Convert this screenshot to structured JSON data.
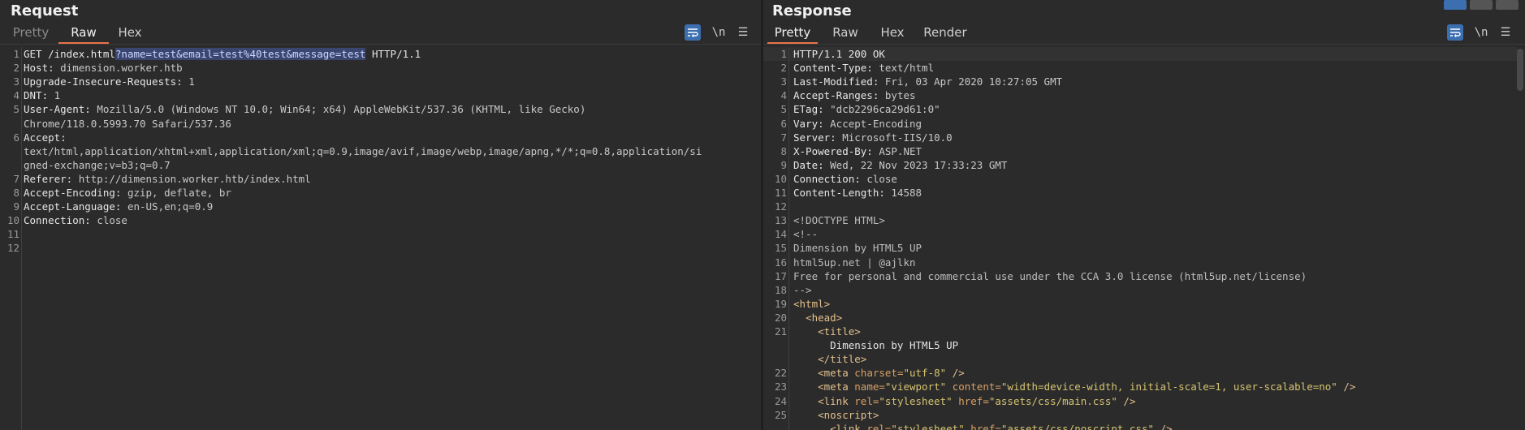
{
  "request": {
    "title": "Request",
    "tabs": [
      "Pretty",
      "Raw",
      "Hex"
    ],
    "active_tab": "Raw",
    "tools": {
      "wrap": "wrap-icon",
      "newline": "\\n",
      "menu": "☰"
    },
    "line_numbers": [
      "1",
      "2",
      "3",
      "4",
      "5",
      "",
      "6",
      "",
      "",
      "7",
      "8",
      "9",
      "10",
      "11",
      "12"
    ],
    "lines": [
      {
        "segments": [
          {
            "t": "GET /index.html",
            "c": "hkey"
          },
          {
            "t": "?name=test&email=test%40test&message=test",
            "c": "sel"
          },
          {
            "t": " HTTP/1.1",
            "c": "hkey"
          }
        ]
      },
      {
        "segments": [
          {
            "t": "Host: ",
            "c": "hkey"
          },
          {
            "t": "dimension.worker.htb",
            "c": "hval"
          }
        ]
      },
      {
        "segments": [
          {
            "t": "Upgrade-Insecure-Requests: ",
            "c": "hkey"
          },
          {
            "t": "1",
            "c": "hval"
          }
        ]
      },
      {
        "segments": [
          {
            "t": "DNT: ",
            "c": "hkey"
          },
          {
            "t": "1",
            "c": "hval"
          }
        ]
      },
      {
        "segments": [
          {
            "t": "User-Agent: ",
            "c": "hkey"
          },
          {
            "t": "Mozilla/5.0 (Windows NT 10.0; Win64; x64) AppleWebKit/537.36 (KHTML, like Gecko)",
            "c": "hval"
          }
        ]
      },
      {
        "segments": [
          {
            "t": "Chrome/118.0.5993.70 Safari/537.36",
            "c": "hval"
          }
        ]
      },
      {
        "segments": [
          {
            "t": "Accept: ",
            "c": "hkey"
          }
        ]
      },
      {
        "segments": [
          {
            "t": "text/html,application/xhtml+xml,application/xml;q=0.9,image/avif,image/webp,image/apng,*/*;q=0.8,application/si",
            "c": "hval"
          }
        ]
      },
      {
        "segments": [
          {
            "t": "gned-exchange;v=b3;q=0.7",
            "c": "hval"
          }
        ]
      },
      {
        "segments": [
          {
            "t": "Referer: ",
            "c": "hkey"
          },
          {
            "t": "http://dimension.worker.htb/index.html",
            "c": "hval"
          }
        ]
      },
      {
        "segments": [
          {
            "t": "Accept-Encoding: ",
            "c": "hkey"
          },
          {
            "t": "gzip, deflate, br",
            "c": "hval"
          }
        ]
      },
      {
        "segments": [
          {
            "t": "Accept-Language: ",
            "c": "hkey"
          },
          {
            "t": "en-US,en;q=0.9",
            "c": "hval"
          }
        ]
      },
      {
        "segments": [
          {
            "t": "Connection: ",
            "c": "hkey"
          },
          {
            "t": "close",
            "c": "hval"
          }
        ]
      },
      {
        "segments": []
      },
      {
        "segments": []
      }
    ]
  },
  "response": {
    "title": "Response",
    "tabs": [
      "Pretty",
      "Raw",
      "Hex",
      "Render"
    ],
    "active_tab": "Pretty",
    "tools": {
      "wrap": "wrap-icon",
      "newline": "\\n",
      "menu": "☰"
    },
    "line_numbers": [
      "1",
      "2",
      "3",
      "4",
      "5",
      "6",
      "7",
      "8",
      "9",
      "10",
      "11",
      "12",
      "13",
      "14",
      "15",
      "16",
      "17",
      "18",
      "19",
      "20",
      "21",
      "",
      "",
      "22",
      "23",
      "24",
      "25",
      ""
    ],
    "lines": [
      {
        "segments": [
          {
            "t": "HTTP/1.1 200 OK",
            "c": "hkey"
          }
        ]
      },
      {
        "segments": [
          {
            "t": "Content-Type: ",
            "c": "hkey"
          },
          {
            "t": "text/html",
            "c": "hval"
          }
        ]
      },
      {
        "segments": [
          {
            "t": "Last-Modified: ",
            "c": "hkey"
          },
          {
            "t": "Fri, 03 Apr 2020 10:27:05 GMT",
            "c": "hval"
          }
        ]
      },
      {
        "segments": [
          {
            "t": "Accept-Ranges: ",
            "c": "hkey"
          },
          {
            "t": "bytes",
            "c": "hval"
          }
        ]
      },
      {
        "segments": [
          {
            "t": "ETag: ",
            "c": "hkey"
          },
          {
            "t": "\"dcb2296ca29d61:0\"",
            "c": "hval"
          }
        ]
      },
      {
        "segments": [
          {
            "t": "Vary: ",
            "c": "hkey"
          },
          {
            "t": "Accept-Encoding",
            "c": "hval"
          }
        ]
      },
      {
        "segments": [
          {
            "t": "Server: ",
            "c": "hkey"
          },
          {
            "t": "Microsoft-IIS/10.0",
            "c": "hval"
          }
        ]
      },
      {
        "segments": [
          {
            "t": "X-Powered-By: ",
            "c": "hkey"
          },
          {
            "t": "ASP.NET",
            "c": "hval"
          }
        ]
      },
      {
        "segments": [
          {
            "t": "Date: ",
            "c": "hkey"
          },
          {
            "t": "Wed, 22 Nov 2023 17:33:23 GMT",
            "c": "hval"
          }
        ]
      },
      {
        "segments": [
          {
            "t": "Connection: ",
            "c": "hkey"
          },
          {
            "t": "close",
            "c": "hval"
          }
        ]
      },
      {
        "segments": [
          {
            "t": "Content-Length: ",
            "c": "hkey"
          },
          {
            "t": "14588",
            "c": "hval"
          }
        ]
      },
      {
        "segments": []
      },
      {
        "segments": [
          {
            "t": "<!DOCTYPE HTML>",
            "c": "cm"
          }
        ]
      },
      {
        "segments": [
          {
            "t": "<!--",
            "c": "cm"
          }
        ]
      },
      {
        "segments": [
          {
            "t": "Dimension by HTML5 UP",
            "c": "cm"
          }
        ]
      },
      {
        "segments": [
          {
            "t": "html5up.net | @ajlkn",
            "c": "cm"
          }
        ]
      },
      {
        "segments": [
          {
            "t": "Free for personal and commercial use under the CCA 3.0 license (html5up.net/license)",
            "c": "cm"
          }
        ]
      },
      {
        "segments": [
          {
            "t": "-->",
            "c": "cm"
          }
        ]
      },
      {
        "segments": [
          {
            "t": "<html>",
            "c": "tag"
          }
        ]
      },
      {
        "segments": [
          {
            "t": "  ",
            "c": "hval"
          },
          {
            "t": "<head>",
            "c": "tag"
          }
        ]
      },
      {
        "segments": [
          {
            "t": "    ",
            "c": "hval"
          },
          {
            "t": "<title>",
            "c": "tag"
          }
        ]
      },
      {
        "segments": [
          {
            "t": "      Dimension by HTML5 UP",
            "c": "hkey"
          }
        ]
      },
      {
        "segments": [
          {
            "t": "    ",
            "c": "hval"
          },
          {
            "t": "</title>",
            "c": "tag"
          }
        ]
      },
      {
        "segments": [
          {
            "t": "    ",
            "c": "hval"
          },
          {
            "t": "<meta ",
            "c": "tag"
          },
          {
            "t": "charset=",
            "c": "attr"
          },
          {
            "t": "\"utf-8\"",
            "c": "str"
          },
          {
            "t": " />",
            "c": "tag"
          }
        ]
      },
      {
        "segments": [
          {
            "t": "    ",
            "c": "hval"
          },
          {
            "t": "<meta ",
            "c": "tag"
          },
          {
            "t": "name=",
            "c": "attr"
          },
          {
            "t": "\"viewport\"",
            "c": "str"
          },
          {
            "t": " content=",
            "c": "attr"
          },
          {
            "t": "\"width=device-width, initial-scale=1, user-scalable=no\"",
            "c": "str"
          },
          {
            "t": " />",
            "c": "tag"
          }
        ]
      },
      {
        "segments": [
          {
            "t": "    ",
            "c": "hval"
          },
          {
            "t": "<link ",
            "c": "tag"
          },
          {
            "t": "rel=",
            "c": "attr"
          },
          {
            "t": "\"stylesheet\"",
            "c": "str"
          },
          {
            "t": " href=",
            "c": "attr"
          },
          {
            "t": "\"assets/css/main.css\"",
            "c": "str"
          },
          {
            "t": " />",
            "c": "tag"
          }
        ]
      },
      {
        "segments": [
          {
            "t": "    ",
            "c": "hval"
          },
          {
            "t": "<noscript>",
            "c": "tag"
          }
        ]
      },
      {
        "segments": [
          {
            "t": "      ",
            "c": "hval"
          },
          {
            "t": "<link ",
            "c": "tag"
          },
          {
            "t": "rel=",
            "c": "attr"
          },
          {
            "t": "\"stylesheet\"",
            "c": "str"
          },
          {
            "t": " href=",
            "c": "attr"
          },
          {
            "t": "\"assets/css/noscript.css\"",
            "c": "str"
          },
          {
            "t": " />",
            "c": "tag"
          }
        ]
      }
    ]
  }
}
